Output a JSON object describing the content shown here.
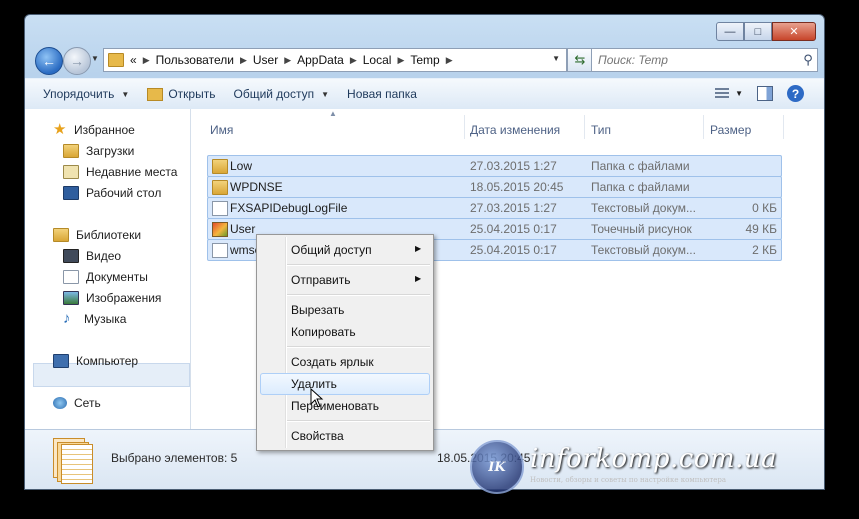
{
  "window": {
    "caption_buttons": [
      "—",
      "□",
      "✕"
    ]
  },
  "address": {
    "prefix": "«",
    "crumbs": [
      "Пользователи",
      "User",
      "AppData",
      "Local",
      "Temp"
    ]
  },
  "search": {
    "placeholder": "Поиск: Temp"
  },
  "toolbar": {
    "organize_label": "Упорядочить",
    "open_label": "Открыть",
    "share_label": "Общий доступ",
    "new_folder_label": "Новая папка"
  },
  "sidebar": {
    "favorites": "Избранное",
    "downloads": "Загрузки",
    "recent": "Недавние места",
    "desktop": "Рабочий стол",
    "libraries": "Библиотеки",
    "video": "Видео",
    "documents": "Документы",
    "images": "Изображения",
    "music": "Музыка",
    "computer": "Компьютер",
    "network": "Сеть"
  },
  "columns": {
    "name": "Имя",
    "date": "Дата изменения",
    "type": "Тип",
    "size": "Размер"
  },
  "files": [
    {
      "name": "Low",
      "date": "27.03.2015 1:27",
      "type": "Папка с файлами",
      "size": "",
      "icon": "folder-icon"
    },
    {
      "name": "WPDNSE",
      "date": "18.05.2015 20:45",
      "type": "Папка с файлами",
      "size": "",
      "icon": "folder-icon"
    },
    {
      "name": "FXSAPIDebugLogFile",
      "date": "27.03.2015 1:27",
      "type": "Текстовый докум...",
      "size": "0 КБ",
      "icon": "text-file-icon"
    },
    {
      "name": "User",
      "date": "25.04.2015 0:17",
      "type": "Точечный рисунок",
      "size": "49 КБ",
      "icon": "bitmap-file-icon"
    },
    {
      "name": "wmsetup",
      "date": "25.04.2015 0:17",
      "type": "Текстовый докум...",
      "size": "2 КБ",
      "icon": "text-file-icon"
    }
  ],
  "context_menu": {
    "share": "Общий доступ",
    "send_to": "Отправить",
    "cut": "Вырезать",
    "copy": "Копировать",
    "create_shortcut": "Создать ярлык",
    "delete": "Удалить",
    "rename": "Переименовать",
    "properties": "Свойства"
  },
  "status": {
    "selected_text": "Выбрано элементов: 5",
    "date_text": "18.05.2015 20:45"
  },
  "watermark": {
    "logo_text": "IK",
    "site": "inforkomp.com.ua",
    "tagline": "Новости, обзоры и советы по настройке компьютера"
  }
}
